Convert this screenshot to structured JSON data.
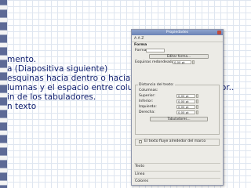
{
  "slide": {
    "lines": [
      "mento.",
      "a (Diapositiva siguiente)",
      "esquinas hacia dentro o hacia afuera",
      "lumnas y el espacio entre columnas: inferior, superior..",
      "in de los tabuladores.",
      "n texto"
    ]
  },
  "dialog": {
    "title": "Propiedades",
    "toolbar": "A  A  Z",
    "forma": {
      "header": "Forma",
      "forma_label": "Forma:",
      "edit_button": "Editar forma..."
    },
    "spacing": {
      "esquinas_label": "Esquinas redondeadas:",
      "esquinas_value": "0,00 pt",
      "distancia_label": "Distancia del texto:",
      "columnas_label": "Columnas:",
      "rows": [
        {
          "label": "Superior:",
          "value": "0,00 pt"
        },
        {
          "label": "Inferior:",
          "value": "0,00 pt"
        },
        {
          "label": "Izquierda:",
          "value": "0,00 pt"
        },
        {
          "label": "Derecha:",
          "value": "0,00 pt"
        }
      ],
      "tabs_button": "Tabuladores..."
    },
    "wrap_checkbox": "El texto fluye alrededor del marco",
    "sections": [
      "Texto",
      "Línea",
      "Colores"
    ]
  }
}
